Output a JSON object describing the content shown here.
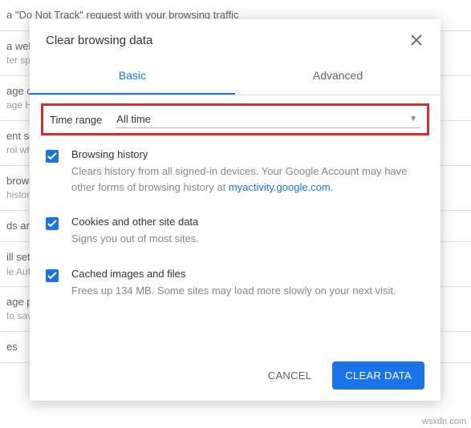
{
  "background": {
    "row0": "a \"Do Not Track\" request with your browsing traffic",
    "row1_title": "a web s",
    "row1_sub": "ter sp",
    "row2_title": "age ce",
    "row2_sub": "age HT",
    "row3_title": "ent set",
    "row3_sub": "rol wha",
    "row4_title": "brows",
    "row4_sub": "histor",
    "row5_title": "ds and",
    "row6_title": "ill sett",
    "row6_sub": "le Aut",
    "row7_title": "age pa",
    "row7_sub": "to sav",
    "row8_title": "es"
  },
  "dialog": {
    "title": "Clear browsing data",
    "tabs": {
      "basic": "Basic",
      "advanced": "Advanced"
    },
    "time_range": {
      "label": "Time range",
      "value": "All time"
    },
    "options": {
      "browsing": {
        "title": "Browsing history",
        "desc_prefix": "Clears history from all signed-in devices. Your Google Account may have other forms of browsing history at ",
        "link": "myactivity.google.com",
        "desc_suffix": "."
      },
      "cookies": {
        "title": "Cookies and other site data",
        "desc": "Signs you out of most sites."
      },
      "cache": {
        "title": "Cached images and files",
        "desc": "Frees up 134 MB. Some sites may load more slowly on your next visit."
      }
    },
    "footer": {
      "cancel": "CANCEL",
      "clear": "CLEAR DATA"
    }
  },
  "attribution": "wsxdn.com"
}
